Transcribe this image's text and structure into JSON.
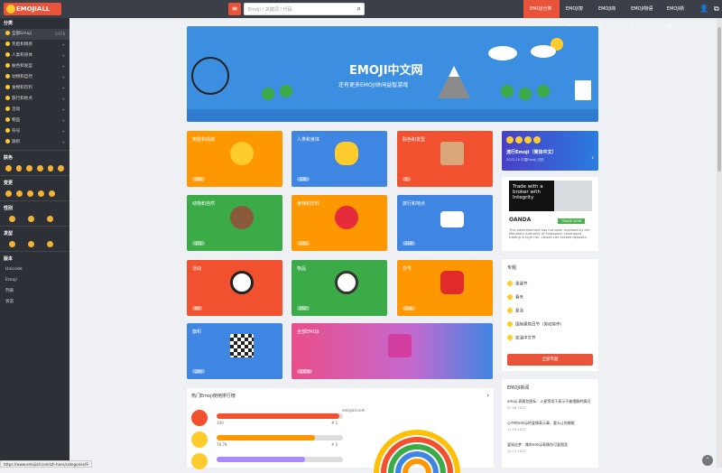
{
  "header": {
    "logo": "EMOJIALL",
    "menu_icon": "menu-icon",
    "search_placeholder": "Emoji / 关键词 / 代码",
    "nav": [
      {
        "label": "EMOJI分类 ▾"
      },
      {
        "label": "EMOJI复制"
      },
      {
        "label": "EMOJI商店"
      },
      {
        "label": "EMOJI物语 ▾"
      },
      {
        "label": "EMOJI新闻"
      }
    ]
  },
  "sidebar": {
    "section_category": "分类",
    "items": [
      {
        "label": "全部Emoji",
        "count": "3,978"
      },
      {
        "label": "笑脸和情感",
        "count": "+"
      },
      {
        "label": "人类和身体",
        "count": "+"
      },
      {
        "label": "肤色和发型",
        "count": "+"
      },
      {
        "label": "动物和自然",
        "count": "+"
      },
      {
        "label": "食物和饮料",
        "count": "+"
      },
      {
        "label": "旅行和地点",
        "count": "+"
      },
      {
        "label": "活动",
        "count": "+"
      },
      {
        "label": "物品",
        "count": "+"
      },
      {
        "label": "符号",
        "count": "+"
      },
      {
        "label": "旗帜",
        "count": "+"
      }
    ],
    "section_skin": "肤色",
    "section_variant": "变更",
    "section_gender": "性别",
    "section_hair": "发型",
    "section_version": "版本",
    "version_items": [
      {
        "label": "Unicode"
      },
      {
        "label": "Emoji"
      },
      {
        "label": "列表"
      },
      {
        "label": "状态"
      }
    ]
  },
  "banner": {
    "title": "EMOJI中文网",
    "subtitle": "还有更多EMOJI休闲益智游戏"
  },
  "cards": [
    {
      "label": "笑脸和情感",
      "count": "166",
      "color": "#ff9800"
    },
    {
      "label": "人类和身体",
      "count": "338",
      "color": "#3f86e2"
    },
    {
      "label": "肤色和发型",
      "count": "5",
      "color": "#f1512f"
    },
    {
      "label": "动物和自然",
      "count": "151",
      "color": "#3aab47"
    },
    {
      "label": "食物和饮料",
      "count": "135",
      "color": "#ff9800"
    },
    {
      "label": "旅行和地点",
      "count": "218",
      "color": "#3f86e2"
    },
    {
      "label": "活动",
      "count": "84",
      "color": "#f1512f"
    },
    {
      "label": "物品",
      "count": "262",
      "color": "#3aab47"
    },
    {
      "label": "符号",
      "count": "224",
      "color": "#ff9800"
    },
    {
      "label": "旗帜",
      "count": "269",
      "color": "#3f86e2"
    },
    {
      "label": "全部EMOJI",
      "count": "3,978",
      "color": "#d65ea7"
    }
  ],
  "side_ad": {
    "title": "流行Emoji（简体中文）",
    "sub": "2022-10 中国Emoji 日历"
  },
  "oanda": {
    "headline": "Trade with a broker with Integrity",
    "brand": "OANDA",
    "cta": "TRADE NOW",
    "note": "This advertisement has not been reviewed by the Monetary Authority of Singapore. Leveraged trading is high risk. Losses can exceed deposits."
  },
  "topics": {
    "title": "专题",
    "items": [
      "圣诞节",
      "春天",
      "复活",
      "国际建筑日节（劳动劳作）",
      "加油中文节"
    ],
    "more": "全部专题"
  },
  "news": {
    "title": "EMOJI新闻",
    "items": [
      {
        "text": "emoji 表情包图标：火星等用于表示不被理解的情况",
        "date": "07.08.2022"
      },
      {
        "text": "心中的emoji的爱情表示事，要么让你眼眶",
        "date": "17.03.2022"
      },
      {
        "text": "爱丽丝梦：像你emoji表情包可爱图案",
        "date": "15.11.2022"
      }
    ]
  },
  "ranking": {
    "title": "热门Emoji使用排行榜",
    "site": "emojiall.com",
    "rows": [
      {
        "value": "100",
        "rank": "# 1",
        "fill": 0.97,
        "color": "#f1512f"
      },
      {
        "value": "76.79",
        "rank": "# 2",
        "fill": 0.78,
        "color": "#ff9800"
      },
      {
        "value": "",
        "rank": "",
        "fill": 0.7,
        "color": "#a78bfa"
      }
    ]
  },
  "status_url": "https://www.emojiall.com/zh-hans/categories/9"
}
